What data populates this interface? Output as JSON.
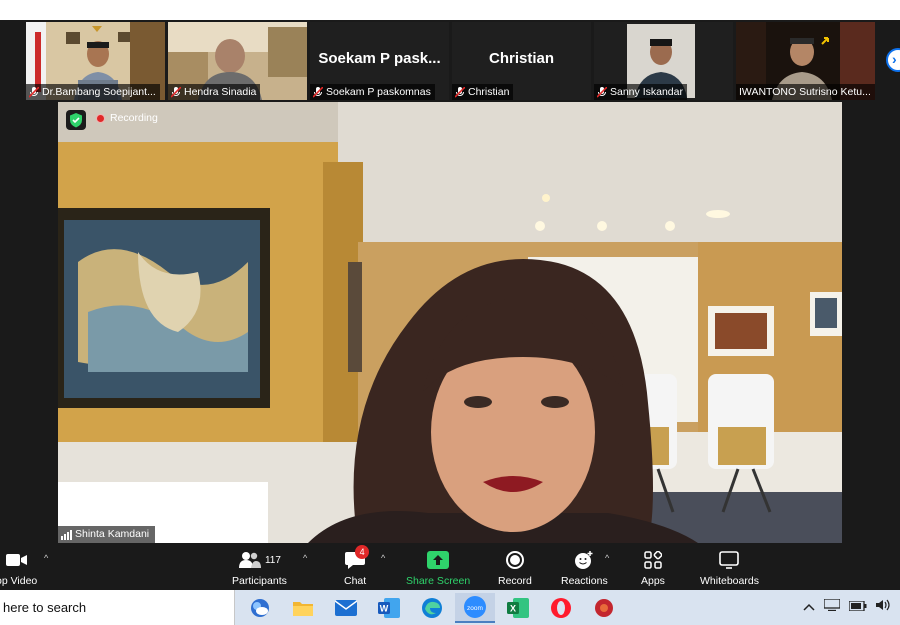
{
  "participants": [
    {
      "name": "Dr.Bambang Soepijant...",
      "type": "video",
      "muted": true
    },
    {
      "name": "Hendra Sinadia",
      "type": "video",
      "muted": true
    },
    {
      "name": "Soekam P paskomnas",
      "display": "Soekam P pask...",
      "type": "name",
      "muted": true
    },
    {
      "name": "Christian",
      "display": "Christian",
      "type": "name",
      "muted": true
    },
    {
      "name": "Sanny Iskandar",
      "type": "video",
      "muted": true
    },
    {
      "name": "IWANTONO Sutrisno Ketu...",
      "type": "video",
      "muted": false
    }
  ],
  "next_page_icon": "chevron-right-icon",
  "main": {
    "recording_label": "Recording",
    "speaker_name": "Shinta Kamdani"
  },
  "toolbar": {
    "video_label": "op Video",
    "participants_count": "117",
    "participants_label": "Participants",
    "chat_badge": "4",
    "chat_label": "Chat",
    "share_label": "Share Screen",
    "record_label": "Record",
    "reactions_label": "Reactions",
    "apps_label": "Apps",
    "whiteboards_label": "Whiteboards"
  },
  "taskbar": {
    "search_text": "here to search",
    "apps": [
      "weather-icon",
      "file-explorer-icon",
      "mail-icon",
      "word-icon",
      "edge-icon",
      "zoom-icon",
      "excel-icon",
      "opera-icon",
      "app-icon"
    ]
  },
  "colors": {
    "zoom_bg": "#1a1a1a",
    "share_green": "#2fd36b",
    "mute_red": "#e02828",
    "accent_blue": "#0e71eb"
  }
}
